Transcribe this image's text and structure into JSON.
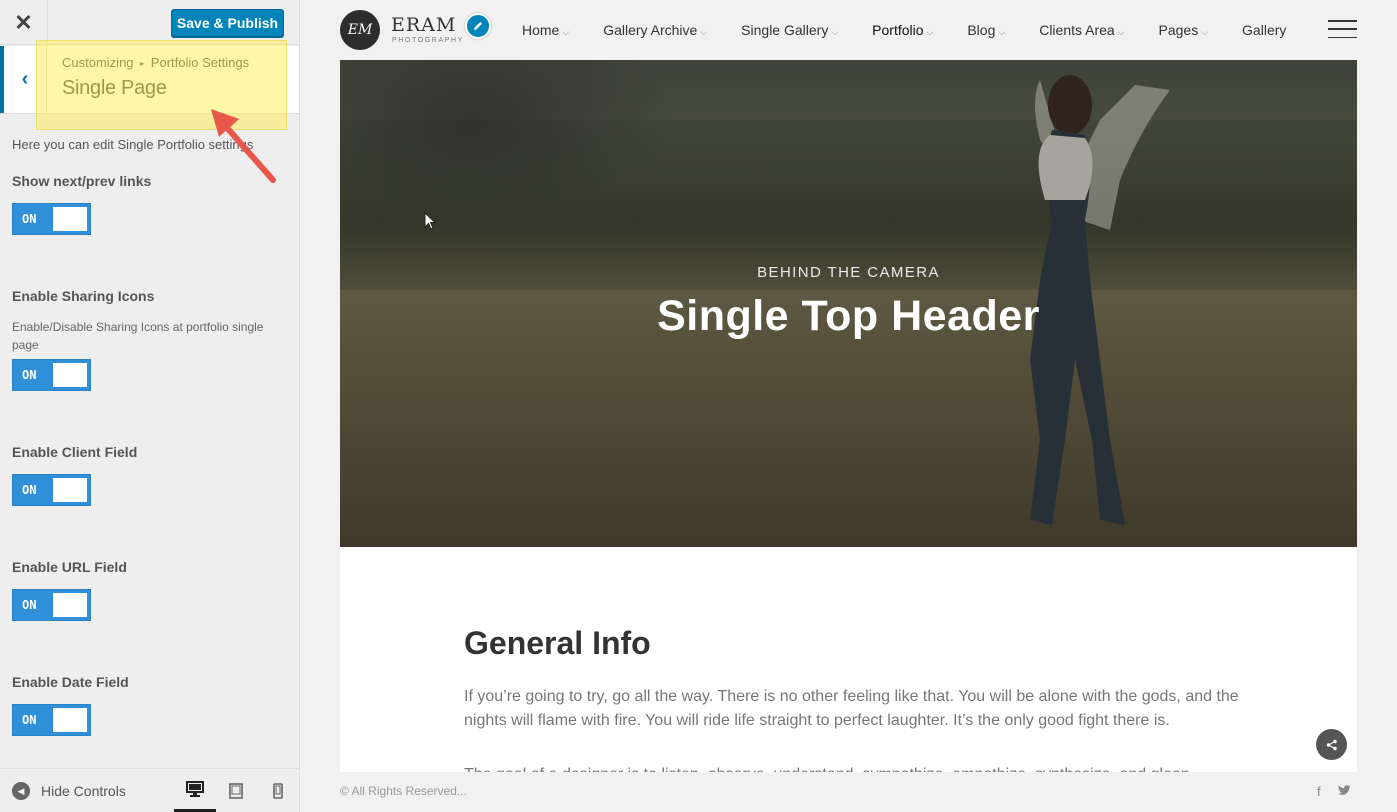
{
  "panel": {
    "close_glyph": "✕",
    "publish_label": "Save & Publish",
    "back_glyph": "‹",
    "breadcrumb_root": "Customizing",
    "breadcrumb_sep": "▸",
    "breadcrumb_parent": "Portfolio Settings",
    "section_title": "Single Page",
    "description": "Here you can edit Single Portfolio settings",
    "controls": [
      {
        "label": "Show next/prev links",
        "description": "",
        "state": "ON"
      },
      {
        "label": "Enable Sharing Icons",
        "description": "Enable/Disable Sharing Icons at portfolio single page",
        "state": "ON"
      },
      {
        "label": "Enable Client Field",
        "description": "",
        "state": "ON"
      },
      {
        "label": "Enable URL Field",
        "description": "",
        "state": "ON"
      },
      {
        "label": "Enable Date Field",
        "description": "",
        "state": "ON"
      }
    ],
    "footer": {
      "hide_label": "Hide Controls",
      "hide_glyph": "◀",
      "devices": [
        "desktop-icon",
        "tablet-icon",
        "mobile-icon"
      ],
      "active_device": "desktop"
    }
  },
  "site": {
    "logo_initials": "EM",
    "logo_name": "ERAM",
    "logo_sub": "PHOTOGRAPHY",
    "nav": [
      {
        "label": "Home",
        "has_children": true
      },
      {
        "label": "Gallery Archive",
        "has_children": true
      },
      {
        "label": "Single Gallery",
        "has_children": true
      },
      {
        "label": "Portfolio",
        "has_children": true
      },
      {
        "label": "Blog",
        "has_children": true
      },
      {
        "label": "Clients Area",
        "has_children": true
      },
      {
        "label": "Pages",
        "has_children": true
      },
      {
        "label": "Gallery",
        "has_children": false
      }
    ],
    "nav_chevron": "⌵",
    "active_nav": "Portfolio",
    "hero": {
      "subtitle": "BEHIND THE CAMERA",
      "title": "Single Top Header"
    },
    "content": {
      "heading": "General Info",
      "paragraph1": "If you’re going to try, go all the way. There is no other feeling like that. You will be alone with the gods, and the nights will flame with fire. You will ride life straight to perfect laughter. It’s the only good fight there is.",
      "paragraph2": "The goal of a designer is to listen, observe, understand, sympathize, empathize, synthesize, and glean"
    },
    "footer": {
      "copyright": "© All Rights Reserved...",
      "social": [
        "f",
        "🐦"
      ]
    }
  },
  "colors": {
    "accent": "#0085ba",
    "toggle_on": "#2f8fd8",
    "highlight": "#ffeb3c",
    "arrow": "#e8574a"
  }
}
